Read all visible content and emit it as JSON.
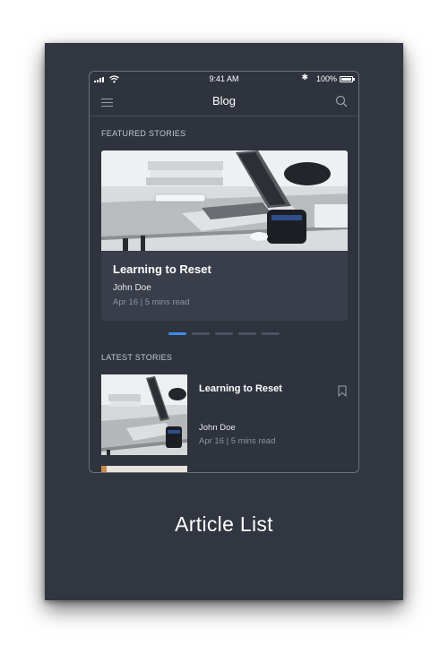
{
  "status_bar": {
    "time": "9:41 AM",
    "battery": "100%"
  },
  "navbar": {
    "title": "Blog"
  },
  "sections": {
    "featured": "FEATURED STORIES",
    "latest": "LATEST STORIES"
  },
  "featured": {
    "title": "Learning to Reset",
    "author": "John Doe",
    "meta": "Apr 16 | 5 mins read",
    "carousel_pages": 5,
    "active_page": 1
  },
  "latest": [
    {
      "title": "Learning to Reset",
      "author": "John Doe",
      "meta": "Apr 16 | 5 mins read"
    }
  ],
  "caption": "Article List",
  "colors": {
    "background": "#323641",
    "screen": "#2f333e",
    "card": "#3a3e4a",
    "accent": "#3d8be8"
  }
}
